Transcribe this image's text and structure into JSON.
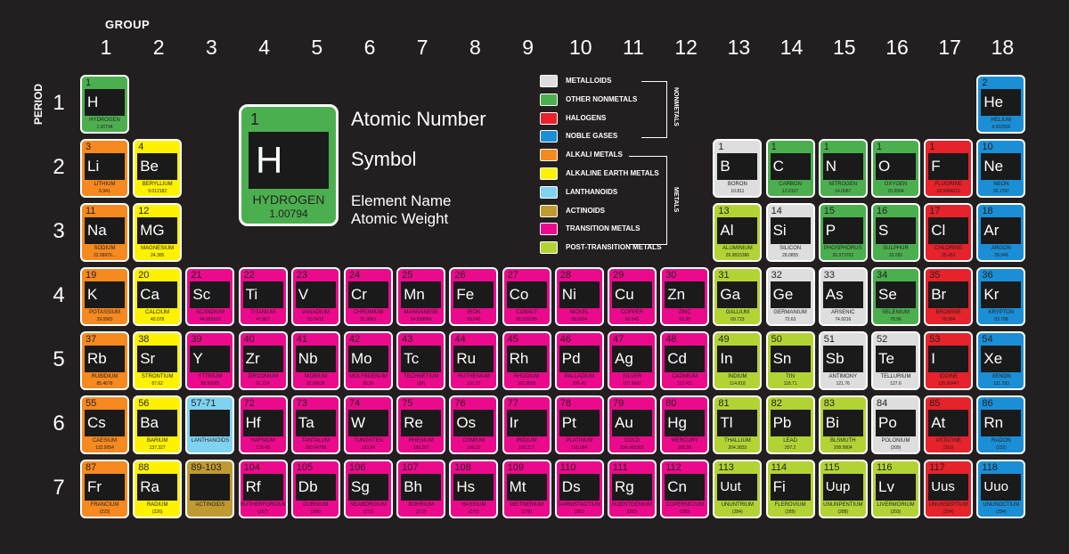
{
  "header": {
    "group_label": "GROUP",
    "period_label": "PERIOD"
  },
  "groups": [
    "1",
    "2",
    "3",
    "4",
    "5",
    "6",
    "7",
    "8",
    "9",
    "10",
    "11",
    "12",
    "13",
    "14",
    "15",
    "16",
    "17",
    "18"
  ],
  "periods": [
    "1",
    "2",
    "3",
    "4",
    "5",
    "6",
    "7"
  ],
  "colors": {
    "metalloid": "#dedede",
    "nonmetal": "#4caf4f",
    "halogen": "#e6222a",
    "noble": "#1a8fd6",
    "alkali": "#f6891f",
    "alkaline": "#fff200",
    "lanthanoid": "#7fd3f1",
    "actinoid": "#bf9a31",
    "transition": "#ec0a8c",
    "post": "#b3d335"
  },
  "key": {
    "number": "1",
    "symbol": "H",
    "name": "HYDROGEN",
    "weight": "1.00794",
    "labels": {
      "number": "Atomic Number",
      "symbol": "Symbol",
      "name": "Element Name",
      "weight": "Atomic Weight"
    }
  },
  "legend": {
    "items": [
      {
        "cat": "metalloid",
        "label": "METALLOIDS"
      },
      {
        "cat": "nonmetal",
        "label": "OTHER NONMETALS"
      },
      {
        "cat": "halogen",
        "label": "HALOGENS"
      },
      {
        "cat": "noble",
        "label": "NOBLE GASES"
      },
      {
        "cat": "alkali",
        "label": "ALKALI METALS"
      },
      {
        "cat": "alkaline",
        "label": "ALKALINE EARTH METALS"
      },
      {
        "cat": "lanthanoid",
        "label": "LANTHANOIDS"
      },
      {
        "cat": "actinoid",
        "label": "ACTINOIDS"
      },
      {
        "cat": "transition",
        "label": "TRANSITION METALS"
      },
      {
        "cat": "post",
        "label": "POST-TRANSITION METALS"
      }
    ],
    "nonmetals_label": "NONMETALS",
    "metals_label": "METALS"
  },
  "elements": [
    {
      "n": "1",
      "s": "H",
      "name": "HYDROGEN",
      "w": "1.00794",
      "g": 1,
      "p": 1,
      "cat": "nonmetal"
    },
    {
      "n": "2",
      "s": "He",
      "name": "HELIUM",
      "w": "4.002602",
      "g": 18,
      "p": 1,
      "cat": "noble"
    },
    {
      "n": "3",
      "s": "Li",
      "name": "LITHIUM",
      "w": "6.941",
      "g": 1,
      "p": 2,
      "cat": "alkali"
    },
    {
      "n": "4",
      "s": "Be",
      "name": "BERYLLIUM",
      "w": "9.012182",
      "g": 2,
      "p": 2,
      "cat": "alkaline"
    },
    {
      "n": "1",
      "s": "B",
      "name": "BORON",
      "w": "10.811",
      "g": 13,
      "p": 2,
      "cat": "metalloid"
    },
    {
      "n": "1",
      "s": "C",
      "name": "CARBON",
      "w": "12.0107",
      "g": 14,
      "p": 2,
      "cat": "nonmetal"
    },
    {
      "n": "1",
      "s": "N",
      "name": "NITROGEN",
      "w": "14.0067",
      "g": 15,
      "p": 2,
      "cat": "nonmetal"
    },
    {
      "n": "1",
      "s": "O",
      "name": "OXYGEN",
      "w": "15.9994",
      "g": 16,
      "p": 2,
      "cat": "nonmetal"
    },
    {
      "n": "1",
      "s": "F",
      "name": "FLUORINE",
      "w": "18.9984032",
      "g": 17,
      "p": 2,
      "cat": "halogen"
    },
    {
      "n": "10",
      "s": "Ne",
      "name": "NEON",
      "w": "20.1797",
      "g": 18,
      "p": 2,
      "cat": "noble"
    },
    {
      "n": "11",
      "s": "Na",
      "name": "SODIUM",
      "w": "22.98976...",
      "g": 1,
      "p": 3,
      "cat": "alkali"
    },
    {
      "n": "12",
      "s": "MG",
      "name": "MAGNESIUM",
      "w": "24.305",
      "g": 2,
      "p": 3,
      "cat": "alkaline"
    },
    {
      "n": "13",
      "s": "Al",
      "name": "ALUMINIUM",
      "w": "26.9815386",
      "g": 13,
      "p": 3,
      "cat": "post"
    },
    {
      "n": "14",
      "s": "Si",
      "name": "SILICON",
      "w": "28.0855",
      "g": 14,
      "p": 3,
      "cat": "metalloid"
    },
    {
      "n": "15",
      "s": "P",
      "name": "PHOSPHORUS",
      "w": "30.973762",
      "g": 15,
      "p": 3,
      "cat": "nonmetal"
    },
    {
      "n": "16",
      "s": "S",
      "name": "SULPHUR",
      "w": "32.065",
      "g": 16,
      "p": 3,
      "cat": "nonmetal"
    },
    {
      "n": "17",
      "s": "Cl",
      "name": "CHLORINE",
      "w": "35.453",
      "g": 17,
      "p": 3,
      "cat": "halogen"
    },
    {
      "n": "18",
      "s": "Ar",
      "name": "ARGON",
      "w": "39.948",
      "g": 18,
      "p": 3,
      "cat": "noble"
    },
    {
      "n": "19",
      "s": "K",
      "name": "POTASSIUM",
      "w": "39.0983",
      "g": 1,
      "p": 4,
      "cat": "alkali"
    },
    {
      "n": "20",
      "s": "Ca",
      "name": "CALCIUM",
      "w": "40.078",
      "g": 2,
      "p": 4,
      "cat": "alkaline"
    },
    {
      "n": "21",
      "s": "Sc",
      "name": "SCANDIUM",
      "w": "44.955912",
      "g": 3,
      "p": 4,
      "cat": "transition"
    },
    {
      "n": "22",
      "s": "Ti",
      "name": "TITANIUM",
      "w": "47.867",
      "g": 4,
      "p": 4,
      "cat": "transition"
    },
    {
      "n": "23",
      "s": "V",
      "name": "VANADIUM",
      "w": "50.9415",
      "g": 5,
      "p": 4,
      "cat": "transition"
    },
    {
      "n": "24",
      "s": "Cr",
      "name": "CHROMIUM",
      "w": "51.9961",
      "g": 6,
      "p": 4,
      "cat": "transition"
    },
    {
      "n": "25",
      "s": "Mn",
      "name": "MANGANESE",
      "w": "54.938045",
      "g": 7,
      "p": 4,
      "cat": "transition"
    },
    {
      "n": "26",
      "s": "Fe",
      "name": "IRON",
      "w": "55.845",
      "g": 8,
      "p": 4,
      "cat": "transition"
    },
    {
      "n": "27",
      "s": "Co",
      "name": "COBALT",
      "w": "58.933195",
      "g": 9,
      "p": 4,
      "cat": "transition"
    },
    {
      "n": "28",
      "s": "Ni",
      "name": "NICKEL",
      "w": "58.6934",
      "g": 10,
      "p": 4,
      "cat": "transition"
    },
    {
      "n": "29",
      "s": "Cu",
      "name": "COPPER",
      "w": "63.546",
      "g": 11,
      "p": 4,
      "cat": "transition"
    },
    {
      "n": "30",
      "s": "Zn",
      "name": "ZINC",
      "w": "65.38",
      "g": 12,
      "p": 4,
      "cat": "transition"
    },
    {
      "n": "31",
      "s": "Ga",
      "name": "GALLIUM",
      "w": "69.723",
      "g": 13,
      "p": 4,
      "cat": "post"
    },
    {
      "n": "32",
      "s": "Ge",
      "name": "GERMANIUM",
      "w": "72.63",
      "g": 14,
      "p": 4,
      "cat": "metalloid"
    },
    {
      "n": "33",
      "s": "As",
      "name": "ARSENIC",
      "w": "74.9216",
      "g": 15,
      "p": 4,
      "cat": "metalloid"
    },
    {
      "n": "34",
      "s": "Se",
      "name": "SELENIUM",
      "w": "78.96",
      "g": 16,
      "p": 4,
      "cat": "nonmetal"
    },
    {
      "n": "35",
      "s": "Br",
      "name": "BROMINE",
      "w": "79.904",
      "g": 17,
      "p": 4,
      "cat": "halogen"
    },
    {
      "n": "36",
      "s": "Kr",
      "name": "KRYPTON",
      "w": "83.798",
      "g": 18,
      "p": 4,
      "cat": "noble"
    },
    {
      "n": "37",
      "s": "Rb",
      "name": "RUBIDIUM",
      "w": "85.4678",
      "g": 1,
      "p": 5,
      "cat": "alkali"
    },
    {
      "n": "38",
      "s": "Sr",
      "name": "STRONTIUM",
      "w": "87.62",
      "g": 2,
      "p": 5,
      "cat": "alkaline"
    },
    {
      "n": "39",
      "s": "Y",
      "name": "YTTRIUM",
      "w": "88.90585",
      "g": 3,
      "p": 5,
      "cat": "transition"
    },
    {
      "n": "40",
      "s": "Zr",
      "name": "ZIRCONIUM",
      "w": "91.224",
      "g": 4,
      "p": 5,
      "cat": "transition"
    },
    {
      "n": "41",
      "s": "Nb",
      "name": "NIOBIUM",
      "w": "92.90638",
      "g": 5,
      "p": 5,
      "cat": "transition"
    },
    {
      "n": "42",
      "s": "Mo",
      "name": "MOLYBDENUM",
      "w": "95.96",
      "g": 6,
      "p": 5,
      "cat": "transition"
    },
    {
      "n": "43",
      "s": "Tc",
      "name": "TECHNETIUM",
      "w": "(98)",
      "g": 7,
      "p": 5,
      "cat": "transition"
    },
    {
      "n": "44",
      "s": "Ru",
      "name": "RUTHENIUM",
      "w": "101.07",
      "g": 8,
      "p": 5,
      "cat": "transition"
    },
    {
      "n": "45",
      "s": "Rh",
      "name": "RHODIUM",
      "w": "102.9055",
      "g": 9,
      "p": 5,
      "cat": "transition"
    },
    {
      "n": "46",
      "s": "Pd",
      "name": "PALLADIUM",
      "w": "106.42",
      "g": 10,
      "p": 5,
      "cat": "transition"
    },
    {
      "n": "47",
      "s": "Ag",
      "name": "SILVER",
      "w": "107.8682",
      "g": 11,
      "p": 5,
      "cat": "transition"
    },
    {
      "n": "48",
      "s": "Cd",
      "name": "CADMIUM",
      "w": "112.411",
      "g": 12,
      "p": 5,
      "cat": "transition"
    },
    {
      "n": "49",
      "s": "In",
      "name": "INDIUM",
      "w": "114.818",
      "g": 13,
      "p": 5,
      "cat": "post"
    },
    {
      "n": "50",
      "s": "Sn",
      "name": "TIN",
      "w": "118.71",
      "g": 14,
      "p": 5,
      "cat": "post"
    },
    {
      "n": "51",
      "s": "Sb",
      "name": "ANTIMONY",
      "w": "121.76",
      "g": 15,
      "p": 5,
      "cat": "metalloid"
    },
    {
      "n": "52",
      "s": "Te",
      "name": "TELLURIUM",
      "w": "127.6",
      "g": 16,
      "p": 5,
      "cat": "metalloid"
    },
    {
      "n": "53",
      "s": "I",
      "name": "IODINE",
      "w": "126.90447",
      "g": 17,
      "p": 5,
      "cat": "halogen"
    },
    {
      "n": "54",
      "s": "Xe",
      "name": "XENON",
      "w": "131.293",
      "g": 18,
      "p": 5,
      "cat": "noble"
    },
    {
      "n": "55",
      "s": "Cs",
      "name": "CAESIUM",
      "w": "132.9054",
      "g": 1,
      "p": 6,
      "cat": "alkali"
    },
    {
      "n": "56",
      "s": "Ba",
      "name": "BARIUM",
      "w": "137.327",
      "g": 2,
      "p": 6,
      "cat": "alkaline"
    },
    {
      "n": "57-71",
      "s": "",
      "name": "LANTHANOIDS",
      "w": "",
      "g": 3,
      "p": 6,
      "cat": "lanthanoid"
    },
    {
      "n": "72",
      "s": "Hf",
      "name": "HAFNIUM",
      "w": "178.49",
      "g": 4,
      "p": 6,
      "cat": "transition"
    },
    {
      "n": "73",
      "s": "Ta",
      "name": "TANTALUM",
      "w": "180.94788",
      "g": 5,
      "p": 6,
      "cat": "transition"
    },
    {
      "n": "74",
      "s": "W",
      "name": "TUNGSTEN",
      "w": "183.84",
      "g": 6,
      "p": 6,
      "cat": "transition"
    },
    {
      "n": "75",
      "s": "Re",
      "name": "RHENIUM",
      "w": "186.207",
      "g": 7,
      "p": 6,
      "cat": "transition"
    },
    {
      "n": "76",
      "s": "Os",
      "name": "OSMIUM",
      "w": "190.23",
      "g": 8,
      "p": 6,
      "cat": "transition"
    },
    {
      "n": "77",
      "s": "Ir",
      "name": "IRIDIUM",
      "w": "192.217",
      "g": 9,
      "p": 6,
      "cat": "transition"
    },
    {
      "n": "78",
      "s": "Pt",
      "name": "PLATINUM",
      "w": "195.084",
      "g": 10,
      "p": 6,
      "cat": "transition"
    },
    {
      "n": "79",
      "s": "Au",
      "name": "GOLD",
      "w": "196.966569",
      "g": 11,
      "p": 6,
      "cat": "transition"
    },
    {
      "n": "80",
      "s": "Hg",
      "name": "MERCURY",
      "w": "200.59",
      "g": 12,
      "p": 6,
      "cat": "transition"
    },
    {
      "n": "81",
      "s": "Tl",
      "name": "THALLIUM",
      "w": "204.3833",
      "g": 13,
      "p": 6,
      "cat": "post"
    },
    {
      "n": "82",
      "s": "Pb",
      "name": "LEAD",
      "w": "207.2",
      "g": 14,
      "p": 6,
      "cat": "post"
    },
    {
      "n": "83",
      "s": "Bi",
      "name": "BLSMUTH",
      "w": "208.9804",
      "g": 15,
      "p": 6,
      "cat": "post"
    },
    {
      "n": "84",
      "s": "Po",
      "name": "POLONIUM",
      "w": "(209)",
      "g": 16,
      "p": 6,
      "cat": "metalloid"
    },
    {
      "n": "85",
      "s": "At",
      "name": "ASTATINE",
      "w": "(210)",
      "g": 17,
      "p": 6,
      "cat": "halogen"
    },
    {
      "n": "86",
      "s": "Rn",
      "name": "RADON",
      "w": "(222)",
      "g": 18,
      "p": 6,
      "cat": "noble"
    },
    {
      "n": "87",
      "s": "Fr",
      "name": "FRANCIUM",
      "w": "(223)",
      "g": 1,
      "p": 7,
      "cat": "alkali"
    },
    {
      "n": "88",
      "s": "Ra",
      "name": "RADIUM",
      "w": "(226)",
      "g": 2,
      "p": 7,
      "cat": "alkaline"
    },
    {
      "n": "89-103",
      "s": "",
      "name": "ACTINOIDS",
      "w": "",
      "g": 3,
      "p": 7,
      "cat": "actinoid"
    },
    {
      "n": "104",
      "s": "Rf",
      "name": "RUTHERFORDIUM",
      "w": "(267)",
      "g": 4,
      "p": 7,
      "cat": "transition"
    },
    {
      "n": "105",
      "s": "Db",
      "name": "DUBNIUM",
      "w": "(268)",
      "g": 5,
      "p": 7,
      "cat": "transition"
    },
    {
      "n": "106",
      "s": "Sg",
      "name": "SEABORGIUM",
      "w": "(271)",
      "g": 6,
      "p": 7,
      "cat": "transition"
    },
    {
      "n": "107",
      "s": "Bh",
      "name": "BOHRIUM",
      "w": "(272)",
      "g": 7,
      "p": 7,
      "cat": "transition"
    },
    {
      "n": "108",
      "s": "Hs",
      "name": "HASSIUM",
      "w": "(270)",
      "g": 8,
      "p": 7,
      "cat": "transition"
    },
    {
      "n": "109",
      "s": "Mt",
      "name": "MEITNERIUM",
      "w": "(276)",
      "g": 9,
      "p": 7,
      "cat": "transition"
    },
    {
      "n": "110",
      "s": "Ds",
      "name": "DARMSTADTIUM",
      "w": "(281)",
      "g": 10,
      "p": 7,
      "cat": "transition"
    },
    {
      "n": "111",
      "s": "Rg",
      "name": "ROENTGENIUM",
      "w": "(280)",
      "g": 11,
      "p": 7,
      "cat": "transition"
    },
    {
      "n": "112",
      "s": "Cn",
      "name": "COPERNICIUM",
      "w": "(285)",
      "g": 12,
      "p": 7,
      "cat": "transition"
    },
    {
      "n": "113",
      "s": "Uut",
      "name": "UNUNTRIUM",
      "w": "(284)",
      "g": 13,
      "p": 7,
      "cat": "post"
    },
    {
      "n": "114",
      "s": "Fi",
      "name": "FLEROVIUM",
      "w": "(289)",
      "g": 14,
      "p": 7,
      "cat": "post"
    },
    {
      "n": "115",
      "s": "Uup",
      "name": "UNUNPENTIUM",
      "w": "(288)",
      "g": 15,
      "p": 7,
      "cat": "post"
    },
    {
      "n": "116",
      "s": "Lv",
      "name": "LIVERMORIUM",
      "w": "(293)",
      "g": 16,
      "p": 7,
      "cat": "post"
    },
    {
      "n": "117",
      "s": "Uus",
      "name": "UNUNSEPTIUM",
      "w": "(294)",
      "g": 17,
      "p": 7,
      "cat": "halogen"
    },
    {
      "n": "118",
      "s": "Uuo",
      "name": "UNUNOCTIUM",
      "w": "(294)",
      "g": 18,
      "p": 7,
      "cat": "noble"
    }
  ]
}
